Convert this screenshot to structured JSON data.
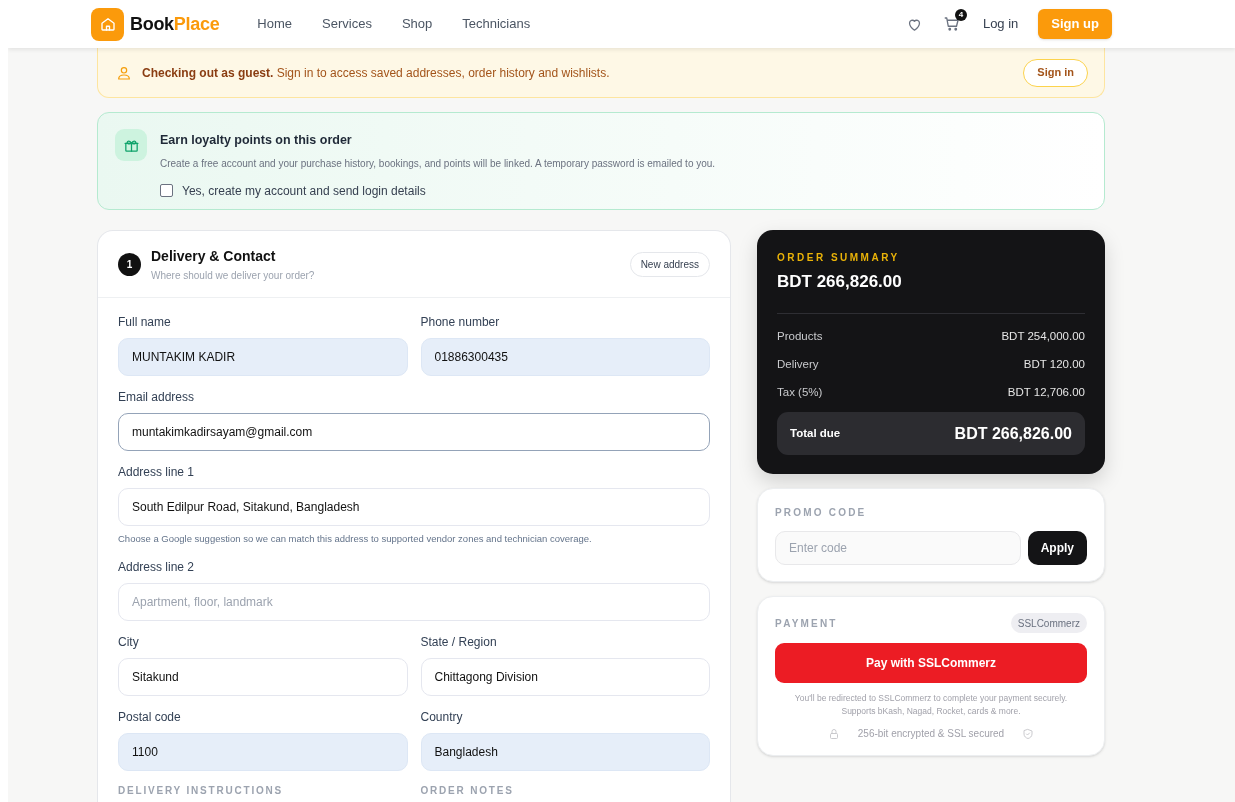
{
  "header": {
    "logo_first": "Book",
    "logo_second": "Place",
    "nav": [
      "Home",
      "Services",
      "Shop",
      "Technicians"
    ],
    "cart_count": "4",
    "login": "Log in",
    "signup": "Sign up"
  },
  "guest_banner": {
    "text": "**Checking out as guest.** Sign in to access saved addresses, order history and wishlists.",
    "button": "Sign in"
  },
  "loyalty": {
    "title": "Earn loyalty points on this order",
    "text": "Create a free account and your purchase history, bookings, and points will be linked. A temporary password is emailed to you.",
    "checkbox": {
      "label": "Yes, create my account and send login details",
      "checked": false
    }
  },
  "delivery": {
    "step": "1",
    "title": "Delivery & Contact",
    "subtitle": "Where should we deliver your order?",
    "button": "New address",
    "fields": [
      {
        "label": "Full name",
        "value": "MUNTAKIM KADIR",
        "wide": false,
        "autofilled": true,
        "focused": false
      },
      {
        "label": "Phone number",
        "value": "01886300435",
        "wide": false,
        "autofilled": true,
        "focused": false
      },
      {
        "label": "Email address",
        "value": "muntakimkadirsayam@gmail.com",
        "wide": true,
        "autofilled": false,
        "focused": true
      },
      {
        "label": "Address line 1",
        "value": "South Edilpur Road, Sitakund, Bangladesh",
        "wide": true,
        "autofilled": false,
        "focused": false,
        "hint": "Choose a Google suggestion so we can match this address to supported vendor zones and technician coverage."
      },
      {
        "label": "Address line 2",
        "placeholder": "Apartment, floor, landmark",
        "wide": true,
        "autofilled": false,
        "focused": false
      },
      {
        "label": "City",
        "value": "Sitakund",
        "wide": false,
        "autofilled": false,
        "focused": false
      },
      {
        "label": "State / Region",
        "value": "Chittagong Division",
        "wide": false,
        "autofilled": false,
        "focused": false
      },
      {
        "label": "Postal code",
        "value": "1100",
        "wide": false,
        "autofilled": true,
        "focused": false
      },
      {
        "label": "Country",
        "value": "Bangladesh",
        "wide": false,
        "autofilled": true,
        "focused": false
      }
    ],
    "section_labels": [
      "DELIVERY INSTRUCTIONS",
      "ORDER NOTES"
    ]
  },
  "summary": {
    "title": "ORDER SUMMARY",
    "amount": "BDT 266,826.00",
    "lines": [
      {
        "label": "Products",
        "value": "BDT 254,000.00"
      },
      {
        "label": "Delivery",
        "value": "BDT 120.00"
      },
      {
        "label": "Tax (5%)",
        "value": "BDT 12,706.00"
      }
    ],
    "total_label": "Total due",
    "total_value": "BDT 266,826.00"
  },
  "promo": {
    "title": "PROMO CODE",
    "placeholder": "Enter code",
    "button": "Apply"
  },
  "payment": {
    "title": "PAYMENT",
    "badge": "SSLCommerz",
    "button": "Pay with SSLCommerz",
    "note": "You'll be redirected to SSLCommerz to complete your payment securely. Supports bKash, Nagad, Rocket, cards & more.",
    "security": "256-bit encrypted & SSL secured"
  }
}
